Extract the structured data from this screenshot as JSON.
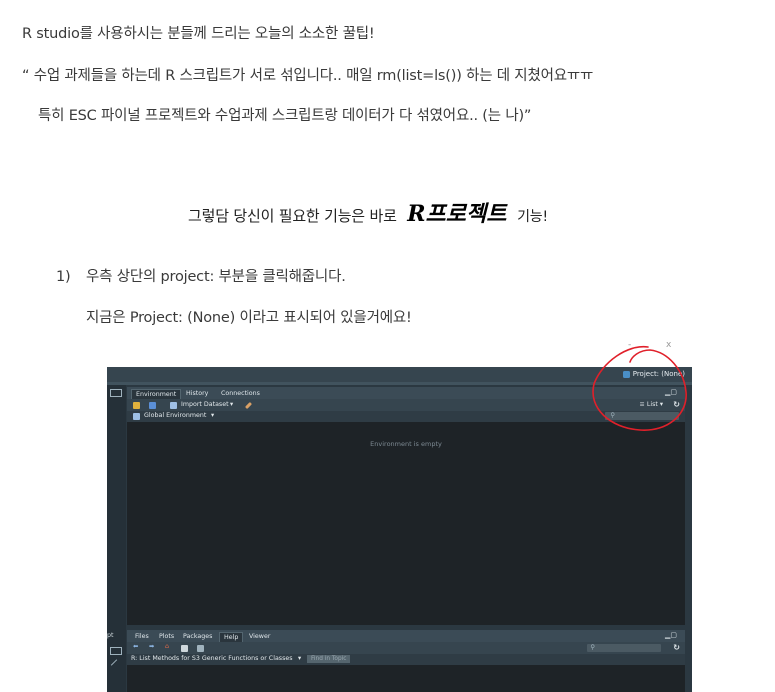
{
  "text": {
    "intro": "R studio를 사용하시는 분들께 드리는 오늘의 소소한 꿀팁!",
    "quote_line1": "“ 수업 과제들을 하는데 R 스크립트가 서로 섞입니다.. 매일 rm(list=ls()) 하는 데 지쳤어요ㅠㅠ",
    "quote_line2": "특히 ESC 파이널 프로젝트와 수업과제 스크립트랑 데이터가 다 섞였어요.. (는 나)”",
    "heading_pre": "그렇담 당신이 필요한 기능은 바로",
    "heading_brand": "R프로젝트",
    "heading_post": "기능!",
    "step1_num": "1)",
    "step1_text": "우측 상단의 project: 부분을 클릭해줍니다.",
    "step2_text": "지금은 Project: (None) 이라고 표시되어 있을거에요!"
  },
  "rstudio": {
    "project_label": "Project: (None)",
    "top_tabs": [
      "Environment",
      "History",
      "Connections"
    ],
    "import_dataset": "Import Dataset",
    "view_mode": "List",
    "env_scope": "Global Environment",
    "empty_message": "Environment is empty",
    "bottom_tabs": [
      "Files",
      "Plots",
      "Packages",
      "Help",
      "Viewer"
    ],
    "help_topic": "R: List Methods for S3 Generic Functions or Classes",
    "find_in_topic": "Find in Topic",
    "left_label": "pt"
  },
  "colors": {
    "annotation": "#e0202a",
    "rstudio_bg": "#1e2327",
    "rstudio_bar": "#36454f"
  }
}
